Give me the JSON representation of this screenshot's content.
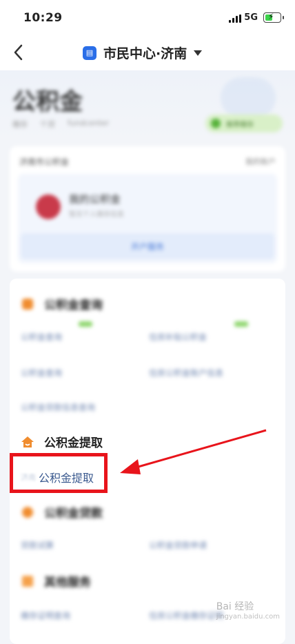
{
  "status": {
    "time": "10:29",
    "network": "5G"
  },
  "nav": {
    "title": "市民中心·济南",
    "app_icon": "doc-icon"
  },
  "header": {
    "title": "公积金",
    "meta": [
      "缴存",
      "个贷",
      "fundcenter"
    ],
    "pill": "推荐缴存"
  },
  "account_card": {
    "selector": "济南市公积金",
    "right_link": "我的账户",
    "name": "我的公积金",
    "sub": "暂无个人缴存信息",
    "open_button": "开户服务"
  },
  "sections": [
    {
      "title": "公积金查询",
      "links": [
        "公积金查询",
        "住房补贴公积金",
        "公积金查询",
        "住房公积金账户信息",
        "公积金贷款信息查询"
      ]
    },
    {
      "title": "公积金提取",
      "links": [
        "济南",
        "公积金提取"
      ]
    },
    {
      "title": "公积金贷款",
      "links": [
        "贷款试算",
        "公积金贷款申请"
      ]
    },
    {
      "title": "其他服务",
      "links": [
        "缴存证明查询",
        "住房公积金缴存证明"
      ]
    }
  ],
  "highlight": {
    "prefix": "济南",
    "label": "公积金提取"
  },
  "colors": {
    "accent": "#2a6ee8",
    "highlight": "#e8141b",
    "icon_orange": "#f08c2e"
  },
  "watermark": {
    "main": "Bai 经验",
    "sub": "jingyan.baidu.com"
  }
}
